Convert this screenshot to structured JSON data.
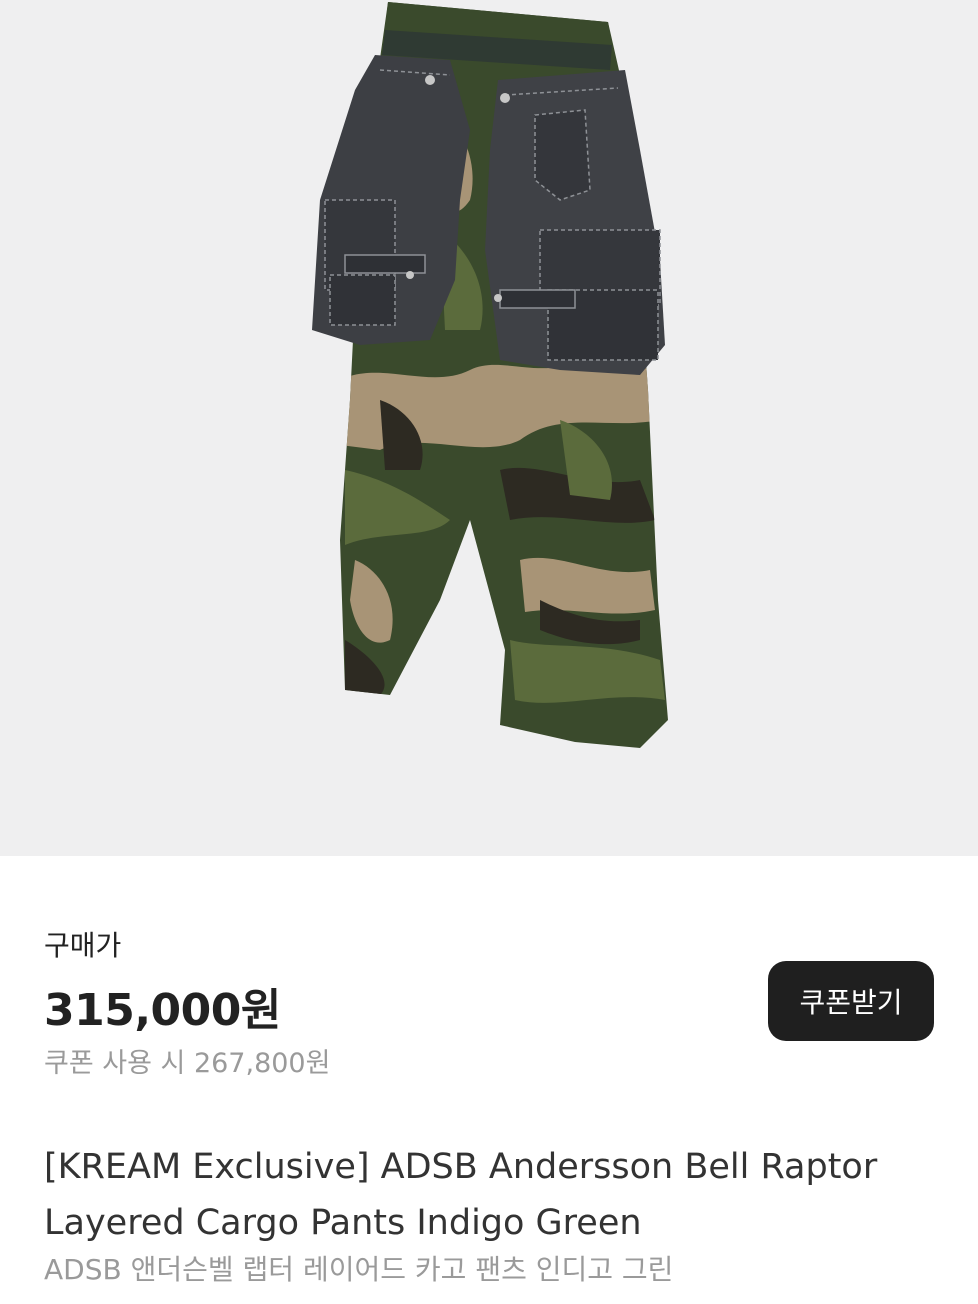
{
  "product": {
    "image_icon": "camo-denim-cargo-pants-image",
    "price_label": "구매가",
    "price": "315,000원",
    "coupon_price": "쿠폰 사용 시 267,800원",
    "coupon_button": "쿠폰받기",
    "title": "[KREAM Exclusive] ADSB Andersson Bell Raptor Layered Cargo Pants Indigo Green",
    "subtitle": "ADSB 앤더슨벨 랩터 레이어드 카고 팬츠 인디고 그린"
  },
  "colors": {
    "background": "#efeff0",
    "button": "#1f1f1f",
    "text": "#222222",
    "muted": "#9a9a9a"
  }
}
